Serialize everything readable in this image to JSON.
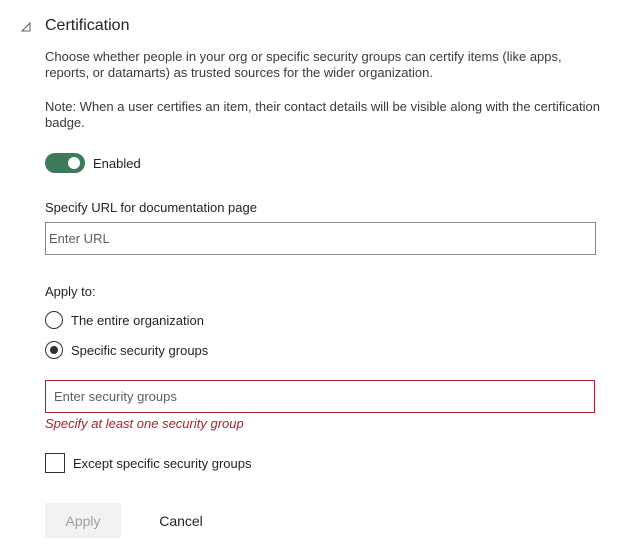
{
  "section": {
    "title": "Certification",
    "collapse_icon": "collapse-triangle-icon"
  },
  "description": "Choose whether people in your org or specific security groups can certify items (like apps, reports, or datamarts) as trusted sources for the wider organization.",
  "note": "Note: When a user certifies an item, their contact details will be visible along with the certification badge.",
  "toggle": {
    "label": "Enabled",
    "state": "on",
    "color": "#3c7a5a"
  },
  "url_field": {
    "label": "Specify URL for documentation page",
    "placeholder": "Enter URL",
    "value": ""
  },
  "apply_to": {
    "label": "Apply to:",
    "options": [
      {
        "label": "The entire organization",
        "selected": false
      },
      {
        "label": "Specific security groups",
        "selected": true
      }
    ]
  },
  "groups_field": {
    "placeholder": "Enter security groups",
    "value": "",
    "error": "Specify at least one security group",
    "error_color": "#a4262c"
  },
  "except_checkbox": {
    "label": "Except specific security groups",
    "checked": false
  },
  "buttons": {
    "apply": "Apply",
    "cancel": "Cancel"
  }
}
